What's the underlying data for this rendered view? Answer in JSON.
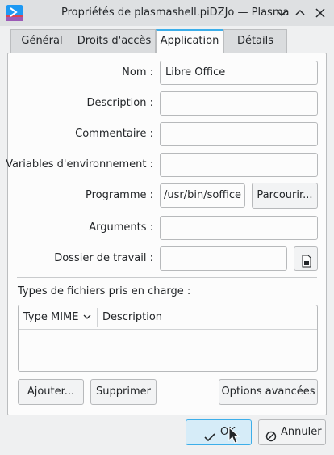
{
  "window": {
    "title": "Propriétés de plasmashell.piDZJo — Plasma"
  },
  "tabs": [
    {
      "label": "Général"
    },
    {
      "label": "Droits d'accès"
    },
    {
      "label": "Application"
    },
    {
      "label": "Détails"
    }
  ],
  "active_tab": "Application",
  "form": {
    "name_label": "Nom :",
    "name_value": "Libre Office",
    "description_label": "Description :",
    "description_value": "",
    "comment_label": "Commentaire :",
    "comment_value": "",
    "env_label": "Variables d'environnement :",
    "env_value": "",
    "program_label": "Programme :",
    "program_value": "/usr/bin/soffice",
    "browse_label": "Parcourir...",
    "arguments_label": "Arguments :",
    "arguments_value": "",
    "workdir_label": "Dossier de travail :",
    "workdir_value": ""
  },
  "filetypes": {
    "title": "Types de fichiers pris en charge :",
    "col_mime": "Type MIME",
    "col_description": "Description",
    "add_label": "Ajouter...",
    "remove_label": "Supprimer",
    "advanced_label": "Options avancées"
  },
  "footer": {
    "ok_label": "OK",
    "cancel_label": "Annuler"
  },
  "colors": {
    "accent": "#3daee9",
    "window_bg": "#eff0f1",
    "titlebar_bg": "#dee0e2"
  }
}
